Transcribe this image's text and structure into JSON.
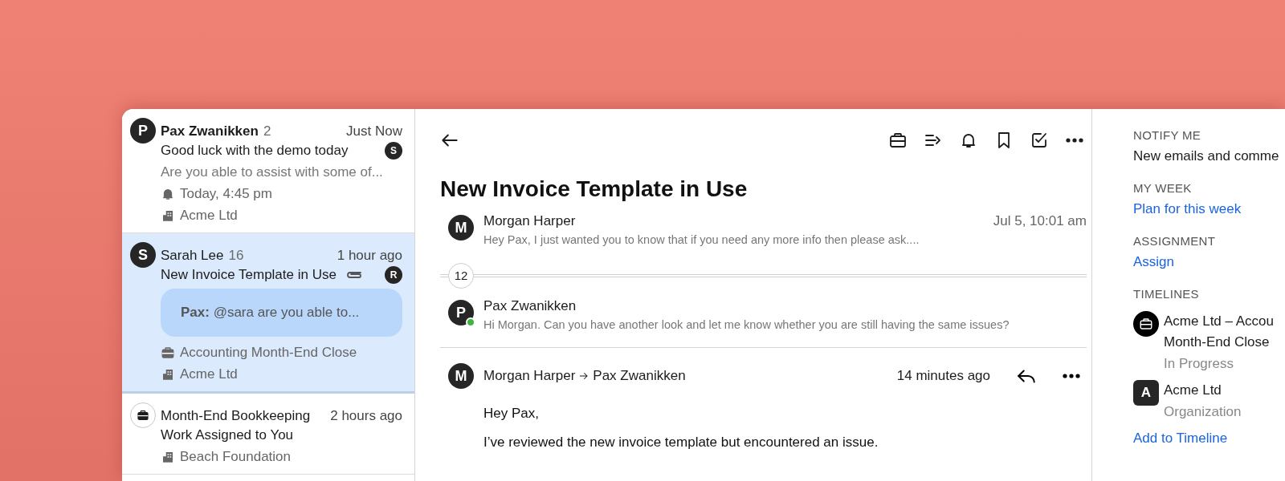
{
  "conversations": [
    {
      "selected": false,
      "unread": true,
      "avatar": {
        "kind": "letter",
        "text": "P"
      },
      "sender": "Pax Zwanikken",
      "count": "2",
      "time": "Just Now",
      "subject": "Good luck with the demo today",
      "attachment": false,
      "badge": "S",
      "preview": "Are you able to assist with some of...",
      "meta": [
        {
          "kind": "reminder",
          "text": "Today, 4:45 pm"
        },
        {
          "kind": "organization",
          "text": "Acme Ltd"
        }
      ]
    },
    {
      "selected": true,
      "unread": false,
      "avatar": {
        "kind": "letter",
        "text": "S"
      },
      "sender": "Sarah Lee",
      "count": "16",
      "time": "1 hour ago",
      "subject": "New Invoice Template in Use",
      "attachment": true,
      "badge": "R",
      "bubble": "**Pax:** @sara are you able to...",
      "meta": [
        {
          "kind": "task",
          "text": "Accounting Month-End Close"
        },
        {
          "kind": "organization",
          "text": "Acme Ltd"
        }
      ]
    },
    {
      "selected": false,
      "unread": false,
      "avatar": {
        "kind": "task"
      },
      "sender": "Month-End Bookkeeping",
      "time": "2 hours ago",
      "subject": "Work Assigned to You",
      "attachment": false,
      "meta": [
        {
          "kind": "organization",
          "text": "Beach Foundation"
        }
      ]
    }
  ],
  "thread": {
    "title": "New Invoice Template in Use",
    "messages": [
      {
        "kind": "collapsed",
        "avatar": "M",
        "online": false,
        "sender": "Morgan Harper",
        "time": "Jul 5, 10:01 am",
        "preview": "Hey Pax, I just wanted you to know that if you need any more info then please ask...."
      },
      {
        "kind": "hidden_count",
        "count": "12"
      },
      {
        "kind": "collapsed",
        "avatar": "P",
        "online": true,
        "sender": "Pax Zwanikken",
        "preview": "Hi Morgan. Can you have another look and let me know whether you are still having the same issues?"
      },
      {
        "kind": "expanded",
        "avatar": "M",
        "sender": "Morgan Harper",
        "recipient": "Pax Zwanikken",
        "time": "14 minutes ago",
        "body": [
          "Hey Pax,",
          "I’ve reviewed the new invoice template but encountered an issue."
        ]
      }
    ]
  },
  "details": [
    {
      "kind": "text",
      "heading": "NOTIFY ME",
      "text": "New emails and comme"
    },
    {
      "kind": "link",
      "heading": "MY WEEK",
      "text": "Plan for this week"
    },
    {
      "kind": "link",
      "heading": "ASSIGNMENT",
      "text": "Assign"
    },
    {
      "kind": "timelines",
      "heading": "TIMELINES",
      "items": [
        {
          "kind": "task",
          "lines": [
            "Acme Ltd – Accou",
            "Month-End Close"
          ],
          "subtitle": "In Progress"
        },
        {
          "kind": "letter",
          "letter": "A",
          "lines": [
            "Acme Ltd"
          ],
          "subtitle": "Organization"
        }
      ],
      "link": "Add to Timeline"
    }
  ]
}
